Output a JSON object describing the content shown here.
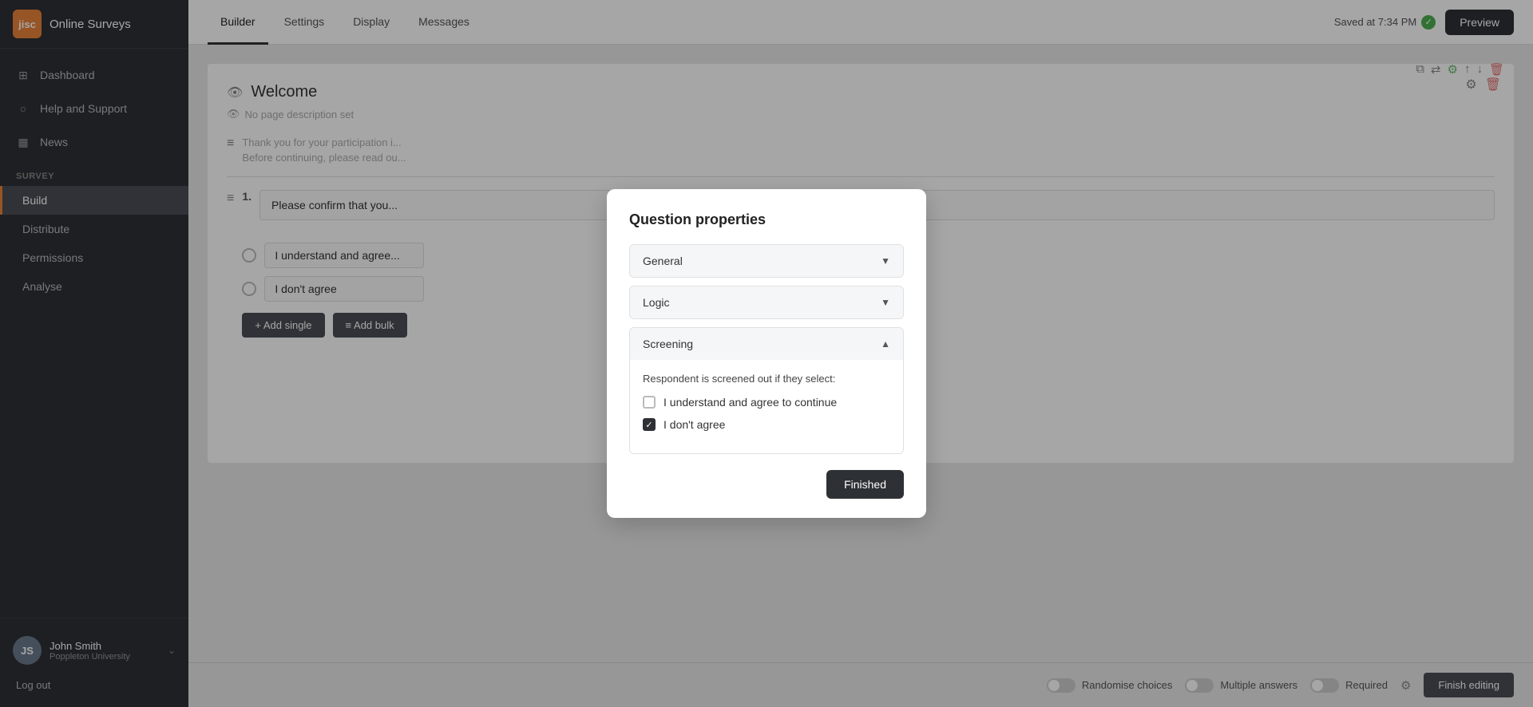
{
  "app": {
    "logo_text": "jisc",
    "name": "Online Surveys"
  },
  "sidebar": {
    "nav_items": [
      {
        "id": "dashboard",
        "label": "Dashboard",
        "icon": "⊞"
      },
      {
        "id": "help",
        "label": "Help and Support",
        "icon": "○"
      },
      {
        "id": "news",
        "label": "News",
        "icon": "▦"
      }
    ],
    "survey_section": "SURVEY",
    "sub_items": [
      {
        "id": "build",
        "label": "Build",
        "active": true
      },
      {
        "id": "distribute",
        "label": "Distribute"
      },
      {
        "id": "permissions",
        "label": "Permissions"
      },
      {
        "id": "analyse",
        "label": "Analyse"
      }
    ],
    "user": {
      "name": "John Smith",
      "org": "Poppleton University",
      "avatar": "JS",
      "chevron": "⌄"
    },
    "logout": "Log out"
  },
  "top_nav": {
    "tabs": [
      {
        "id": "builder",
        "label": "Builder",
        "active": true
      },
      {
        "id": "settings",
        "label": "Settings"
      },
      {
        "id": "display",
        "label": "Display"
      },
      {
        "id": "messages",
        "label": "Messages"
      }
    ],
    "saved_text": "Saved at 7:34 PM",
    "preview_label": "Preview"
  },
  "survey": {
    "welcome_icon": "👁",
    "welcome_title": "Welcome",
    "no_desc_icon": "👁",
    "no_desc": "No page description set",
    "question_number": "1.",
    "question_text": "Please confirm that you...",
    "options": [
      {
        "id": "agree",
        "label": "I understand and agree..."
      },
      {
        "id": "disagree",
        "label": "I don't agree"
      }
    ],
    "add_single": "+ Add single",
    "add_bulk": "≡ Add bulk",
    "finish_editing": "Finish editing",
    "bottom_toggles": [
      {
        "label": "Randomise choices"
      },
      {
        "label": "Multiple answers"
      },
      {
        "label": "Required"
      }
    ]
  },
  "modal": {
    "title": "Question properties",
    "sections": [
      {
        "id": "general",
        "label": "General",
        "open": false
      },
      {
        "id": "logic",
        "label": "Logic",
        "open": false
      },
      {
        "id": "screening",
        "label": "Screening",
        "open": true
      }
    ],
    "screening_label": "Respondent is screened out if they select:",
    "checkboxes": [
      {
        "id": "agree",
        "label": "I understand and agree to continue",
        "checked": false
      },
      {
        "id": "disagree",
        "label": "I don't agree",
        "checked": true
      }
    ],
    "finished_label": "Finished"
  }
}
